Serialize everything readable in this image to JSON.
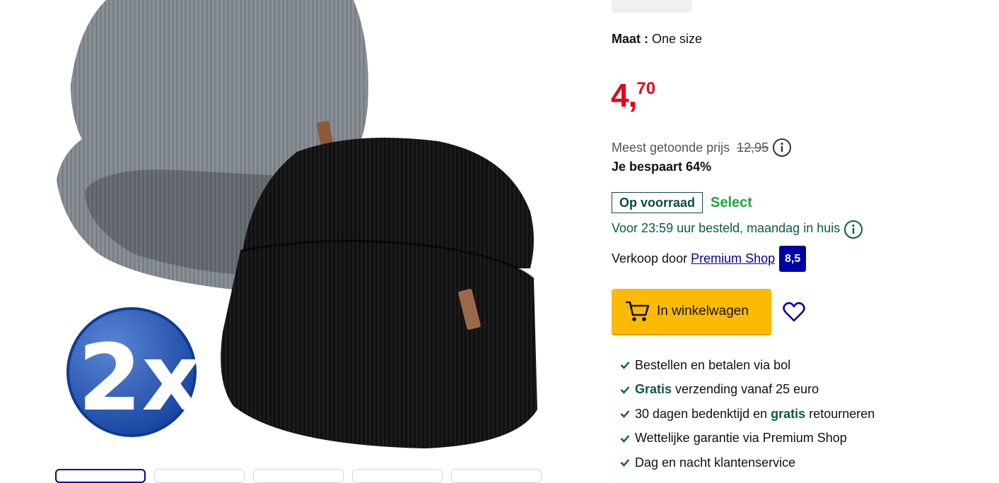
{
  "product": {
    "image_alt": "Grijze en zwarte muts, 2x",
    "badge_text": "2x"
  },
  "size": {
    "label": "Maat :",
    "value": "One size"
  },
  "price": {
    "integer": "4,",
    "fraction": "70",
    "color": "#e0071c"
  },
  "reference": {
    "label": "Meest getoonde prijs",
    "old_price": "12,95",
    "saving": "Je bespaart 64%"
  },
  "stock": {
    "status": "Op voorraad",
    "program": "Select"
  },
  "delivery": {
    "text": "Voor 23:59 uur besteld, maandag in huis"
  },
  "seller": {
    "prefix": "Verkoop door",
    "name": "Premium Shop",
    "rating": "8,5"
  },
  "cart": {
    "label": "In winkelwagen",
    "color": "#fcbb03"
  },
  "usps": [
    {
      "text": "Bestellen en betalen via bol"
    },
    {
      "highlight": "Gratis",
      "text": "verzending vanaf 25 euro"
    },
    {
      "before": "30 dagen bedenktijd en",
      "highlight": "gratis",
      "after": "retourneren"
    },
    {
      "text": "Wettelijke garantie via Premium Shop"
    },
    {
      "text": "Dag en nacht klantenservice"
    }
  ],
  "icons": {
    "info": "info-icon",
    "cart": "cart-icon",
    "wishlist": "heart-icon",
    "check": "check-icon"
  }
}
